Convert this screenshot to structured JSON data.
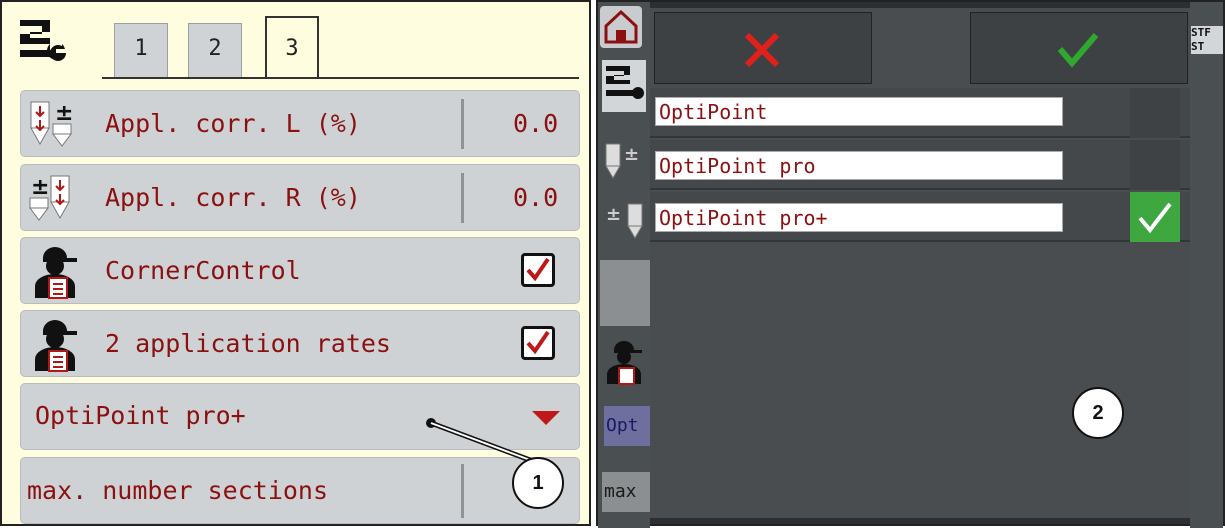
{
  "left": {
    "tabs": [
      "1",
      "2",
      "3"
    ],
    "active_tab": "3",
    "rows": [
      {
        "label": "Appl. corr. L (%)",
        "value": "0.0"
      },
      {
        "label": "Appl. corr. R (%)",
        "value": "0.0"
      },
      {
        "label": "CornerControl",
        "checked": true
      },
      {
        "label": "2 application rates",
        "checked": true
      }
    ],
    "dropdown": {
      "value": "OptiPoint pro+"
    },
    "last_row": {
      "label": "max. number sections"
    },
    "callout": "1"
  },
  "right": {
    "options": [
      {
        "label": "OptiPoint",
        "selected": false
      },
      {
        "label": "OptiPoint pro",
        "selected": false
      },
      {
        "label": "OptiPoint pro+",
        "selected": true
      }
    ],
    "bg_fragments": {
      "opt": "Opt",
      "max": "max",
      "st1": "STF",
      "st2": "ST"
    },
    "callout": "2"
  },
  "colors": {
    "text_red": "#8b1111",
    "cancel_red": "#e0201a",
    "ok_green": "#2ea82e",
    "dark_bg": "#2b2f31"
  }
}
